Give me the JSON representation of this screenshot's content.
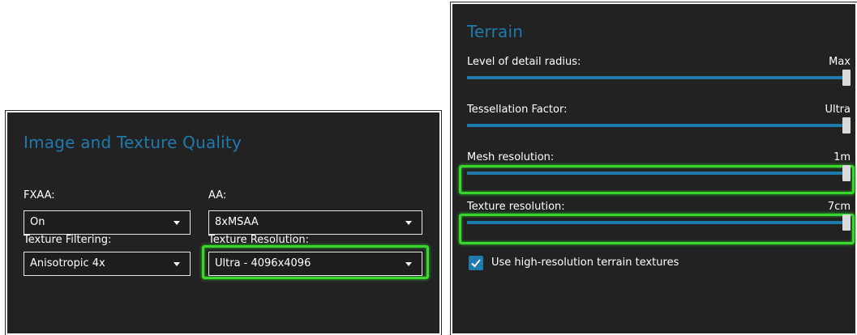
{
  "colors": {
    "accent": "#1f7aad",
    "highlight": "#39d62d",
    "panel_bg": "#222222",
    "text": "#ffffff"
  },
  "left_panel": {
    "title": "Image and Texture Quality",
    "fxaa": {
      "label": "FXAA:",
      "value": "On"
    },
    "aa": {
      "label": "AA:",
      "value": "8xMSAA"
    },
    "texture_filtering": {
      "label": "Texture Filtering:",
      "value": "Anisotropic 4x"
    },
    "texture_resolution": {
      "label": "Texture Resolution:",
      "value": "Ultra - 4096x4096"
    }
  },
  "right_panel": {
    "title": "Terrain",
    "sliders": [
      {
        "label": "Level of detail radius:",
        "value": "Max",
        "level": 1.0
      },
      {
        "label": "Tessellation Factor:",
        "value": "Ultra",
        "level": 1.0
      },
      {
        "label": "Mesh resolution:",
        "value": "1m",
        "level": 1.0
      },
      {
        "label": "Texture resolution:",
        "value": "7cm",
        "level": 1.0
      }
    ],
    "checkbox": {
      "label": "Use high-resolution terrain textures",
      "checked": true
    }
  }
}
